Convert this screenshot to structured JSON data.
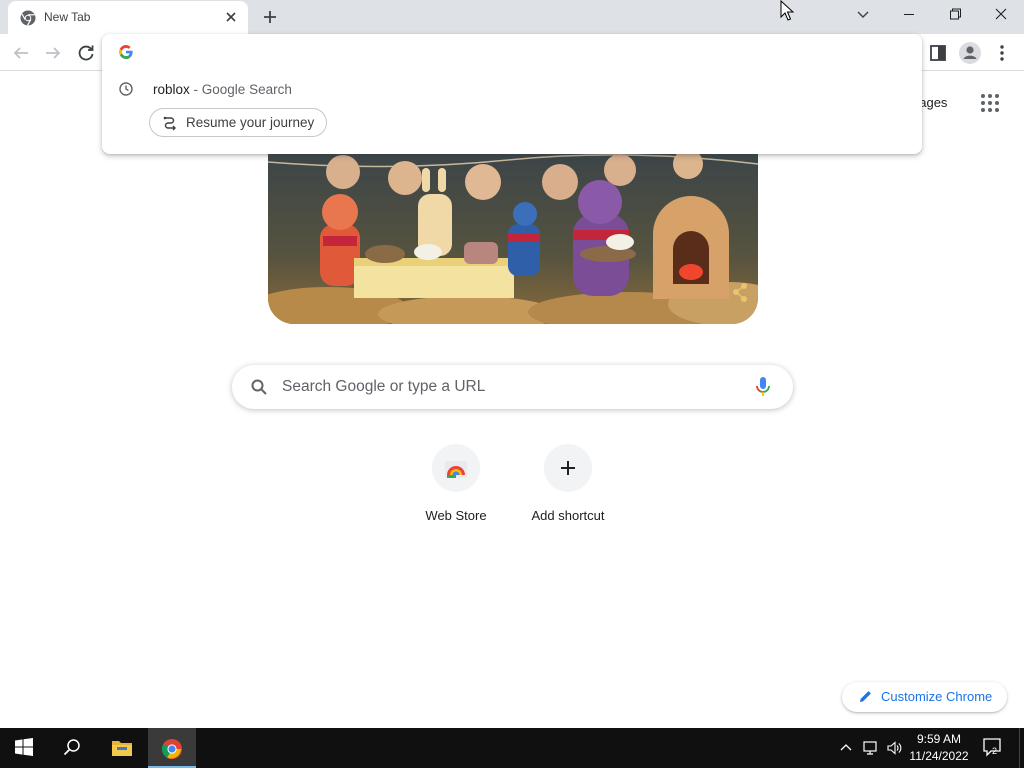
{
  "tab": {
    "title": "New Tab",
    "favicon": "chrome-logo-icon"
  },
  "omnibox": {
    "value": "",
    "suggestion": {
      "text": "roblox",
      "separator": " - ",
      "description": "Google Search"
    },
    "journey_label": "Resume your journey"
  },
  "page": {
    "images_link": "nages",
    "search_placeholder": "Search Google or type a URL",
    "shortcuts": [
      {
        "label": "Web Store",
        "icon": "web-store-icon"
      },
      {
        "label": "Add shortcut",
        "icon": "plus-icon"
      }
    ],
    "customize_label": "Customize Chrome"
  },
  "taskbar": {
    "time": "9:59 AM",
    "date": "11/24/2022",
    "notification_count": "2"
  },
  "colors": {
    "accent_blue": "#1a73e8",
    "tabstrip": "#dee1e6",
    "taskbar": "#101010"
  }
}
